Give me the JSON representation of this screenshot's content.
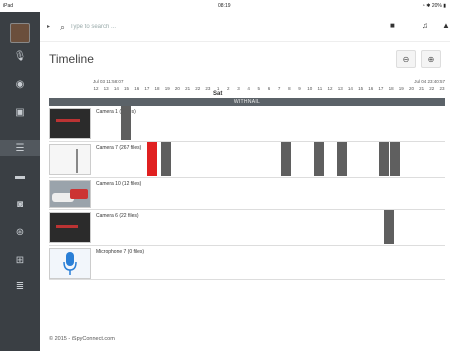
{
  "status_bar": {
    "device": "iPad",
    "time": "08:19",
    "battery": "20%"
  },
  "search": {
    "placeholder": "Type to search ..."
  },
  "page": {
    "title": "Timeline",
    "footer": "© 2015 - iSpyConnect.com"
  },
  "timeline": {
    "start": "Jul 03 11:58:07",
    "end": "Jul 04 23:40:57",
    "day_label": "Sat",
    "group": "WITHNAIL",
    "hours": [
      "12",
      "13",
      "14",
      "15",
      "16",
      "17",
      "18",
      "19",
      "20",
      "21",
      "22",
      "23",
      "1",
      "2",
      "3",
      "4",
      "5",
      "6",
      "7",
      "8",
      "9",
      "10",
      "11",
      "12",
      "13",
      "14",
      "15",
      "16",
      "17",
      "18",
      "19",
      "20",
      "21",
      "22",
      "23"
    ]
  },
  "rows": [
    {
      "label": "Camera 1 (3 files)",
      "thumb": "camera-dark"
    },
    {
      "label": "Camera 7 (267 files)",
      "thumb": "camera-light"
    },
    {
      "label": "Camera 10 (12 files)",
      "thumb": "camera-car"
    },
    {
      "label": "Camera 6 (22 files)",
      "thumb": "camera-dark"
    },
    {
      "label": "Microphone 7 (0 files)",
      "thumb": "microphone"
    }
  ],
  "colors": {
    "sidebar": "#3a3f44",
    "bar": "#5f5f5f",
    "alert_bar": "#e02020",
    "group_bar": "#5b6268"
  }
}
